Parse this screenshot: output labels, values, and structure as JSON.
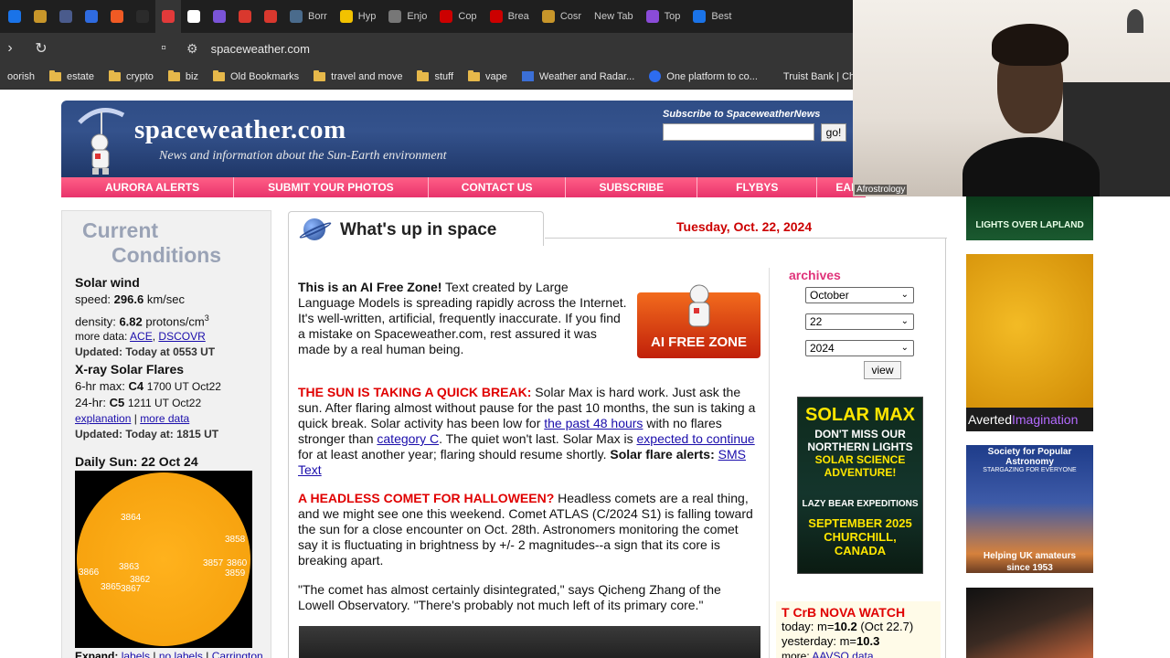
{
  "browser": {
    "tabs": [
      {
        "label": "",
        "icon": "chrome-icon",
        "color": "#1a73e8"
      },
      {
        "label": "",
        "icon": "coin-icon",
        "color": "#c8962a"
      },
      {
        "label": "",
        "icon": "globe-icon",
        "color": "#4a5b8c"
      },
      {
        "label": "",
        "icon": "dropbox-icon",
        "color": "#2f6be0"
      },
      {
        "label": "",
        "icon": "brave-icon",
        "color": "#f05a24"
      },
      {
        "label": "",
        "icon": "blank-icon",
        "color": "#2b2b2b"
      },
      {
        "label": "",
        "icon": "adobe-icon",
        "color": "#e23a3a"
      },
      {
        "label": "",
        "icon": "amazon-icon",
        "color": "#ffffff"
      },
      {
        "label": "",
        "icon": "mail-icon",
        "color": "#7a54d8"
      },
      {
        "label": "",
        "icon": "gmail-icon",
        "color": "#d9382e"
      },
      {
        "label": "",
        "icon": "gmail-icon",
        "color": "#d9382e"
      },
      {
        "label": "Borr",
        "icon": "news-icon",
        "color": "#4a6b8c"
      },
      {
        "label": "Hyp",
        "icon": "star-icon",
        "color": "#f2c200"
      },
      {
        "label": "Enjo",
        "icon": "circle-icon",
        "color": "#777777"
      },
      {
        "label": "Cop",
        "icon": "cnn-icon",
        "color": "#cc0000"
      },
      {
        "label": "Brea",
        "icon": "cnn-icon",
        "color": "#cc0000"
      },
      {
        "label": "Cosr",
        "icon": "coin-icon",
        "color": "#c8962a"
      },
      {
        "label": "New Tab",
        "icon": "",
        "color": ""
      },
      {
        "label": "Top",
        "icon": "twitch-icon",
        "color": "#8a4bd8"
      },
      {
        "label": "Best",
        "icon": "c-icon",
        "color": "#1a73e8"
      }
    ],
    "url": "spaceweather.com",
    "bookmarks": [
      "oorish",
      "estate",
      "crypto",
      "biz",
      "Old Bookmarks",
      "travel and move",
      "stuff",
      "vape",
      "Weather and Radar...",
      "One platform to co...",
      "Truist Bank | Checki..."
    ]
  },
  "site": {
    "title": "spaceweather.com",
    "tagline": "News and information about the Sun-Earth environment",
    "subscribe_label": "Subscribe to SpaceweatherNews",
    "subscribe_placeholder": "",
    "go_label": "go!",
    "nav": [
      "AURORA ALERTS",
      "SUBMIT YOUR PHOTOS",
      "CONTACT US",
      "SUBSCRIBE",
      "FLYBYS",
      "EARTH"
    ]
  },
  "conditions": {
    "title_line1": "Current",
    "title_line2": "Conditions",
    "solar_wind": {
      "heading": "Solar wind",
      "speed_label": "speed:",
      "speed_value": "296.6",
      "speed_unit": "km/sec",
      "density_label": "density:",
      "density_value": "6.82",
      "density_unit": "protons/cm",
      "density_exp": "3",
      "more_label": "more data:",
      "link_ace": "ACE",
      "link_dscovr": "DSCOVR",
      "updated": "Updated: Today at 0553 UT"
    },
    "xray": {
      "heading": "X-ray Solar Flares",
      "six_label": "6-hr max:",
      "six_class": "C4",
      "six_time": "1700 UT Oct22",
      "day_label": "24-hr:",
      "day_class": "C5",
      "day_time": "1211 UT Oct22",
      "link_explanation": "explanation",
      "link_more": "more data",
      "updated": "Updated: Today at: 1815 UT"
    },
    "daily_sun": "Daily Sun: 22 Oct 24",
    "sunspots": [
      "3864",
      "3858",
      "3863",
      "3866",
      "3862",
      "3865",
      "3867",
      "3857",
      "3860",
      "3859"
    ],
    "expand_label": "Expand:",
    "expand_links": [
      "labels",
      "no labels",
      "Carrington"
    ]
  },
  "main": {
    "tab_title": "What's up in space",
    "date": "Tuesday, Oct. 22, 2024",
    "p1_bold": "This is an AI Free Zone!",
    "p1_text": "Text created by Large Language Models is spreading rapidly across the Internet. It's well-written, artificial, frequently inaccurate. If you find a mistake on Spaceweather.com, rest assured it was made by a real human being.",
    "ai_badge": "AI FREE ZONE",
    "p2_head": "THE SUN IS TAKING A QUICK BREAK:",
    "p2_a": "Solar Max is hard work. Just ask the sun. After flaring almost without pause for the past 10 months, the sun is taking a quick break. Solar activity has been low for",
    "p2_link1": "the past 48 hours",
    "p2_b": "with no flares stronger than",
    "p2_link2": "category C",
    "p2_c": ". The quiet won't last. Solar Max is",
    "p2_link3": "expected to continue",
    "p2_d": "for at least another year; flaring should resume shortly.",
    "p2_alert": "Solar flare alerts:",
    "p2_link4": "SMS Text",
    "p3_head": "A HEADLESS COMET FOR HALLOWEEN?",
    "p3_text": "Headless comets are a real thing, and we might see one this weekend. Comet ATLAS (C/2024 S1) is falling toward the sun for a close encounter on Oct. 28th. Astronomers monitoring the comet say it is fluctuating in brightness by +/- 2 magnitudes--a sign that its core is breaking apart.",
    "p4_text": "\"The comet has almost certainly disintegrated,\" says Qicheng Zhang of the Lowell Observatory. \"There's probably not much left of its primary core.\""
  },
  "archives": {
    "label": "archives",
    "month": "October",
    "day": "22",
    "year": "2024",
    "view_label": "view"
  },
  "solar_ad": {
    "line1": "SOLAR MAX",
    "line2": "DON'T MISS OUR NORTHERN LIGHTS",
    "line3": "SOLAR SCIENCE ADVENTURE!",
    "line4": "LAZY BEAR EXPEDITIONS",
    "line5": "SEPTEMBER 2025 CHURCHILL, CANADA"
  },
  "nova": {
    "title": "T CrB NOVA WATCH",
    "today_label": "today: m=",
    "today_value": "10.2",
    "today_note": "(Oct 22.7)",
    "yesterday_label": "yesterday: m=",
    "yesterday_value": "10.3",
    "more_label": "more:",
    "more_link": "AAVSO data"
  },
  "ads": {
    "ad1_text": "LIGHTS OVER LAPLAND",
    "ad2_a": "Averted",
    "ad2_b": "Imagination",
    "ad3_title": "Society for Popular Astronomy",
    "ad3_sub": "STARGAZING FOR EVERYONE",
    "ad3_bottom": "Helping UK amateurs since 1953"
  },
  "webcam": {
    "name": "Afrostrology"
  },
  "colors": {
    "nav_pink": "#e8336b",
    "banner_blue": "#2f4d86",
    "alert_red": "#e00000",
    "archives_pink": "#e0337a"
  }
}
